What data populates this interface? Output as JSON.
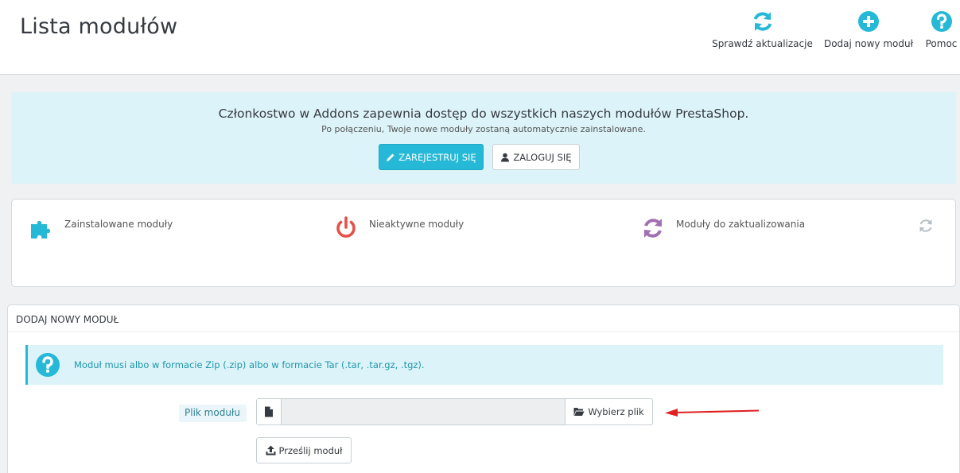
{
  "header": {
    "title": "Lista modułów",
    "toolbar": {
      "check_updates": "Sprawdź aktualizacje",
      "add_module": "Dodaj nowy moduł",
      "help": "Pomoc"
    }
  },
  "addons": {
    "title": "Członkostwo w Addons zapewnia dostęp do wszystkich naszych modułów PrestaShop.",
    "subtitle": "Po połączeniu, Twoje nowe moduły zostaną automatycznie zainstalowane.",
    "register_label": "Zarejestruj się",
    "login_label": "Zaloguj się"
  },
  "kpis": {
    "installed": "Zainstalowane moduły",
    "inactive": "Nieaktywne moduły",
    "to_update": "Moduły do zaktualizowania"
  },
  "upload": {
    "heading": "Dodaj nowy moduł",
    "info": "Moduł musi albo w formacie Zip (.zip) albo w formacie Tar (.tar, .tar.gz, .tgz).",
    "file_label": "Plik modułu",
    "file_value": "",
    "choose_label": "Wybierz plik",
    "submit_label": "Prześlij moduł"
  },
  "colors": {
    "accent": "#25b9d7",
    "puzzle": "#25b9d7",
    "power": "#e5524a",
    "update": "#a26fb3",
    "arrow": "#e02020"
  }
}
